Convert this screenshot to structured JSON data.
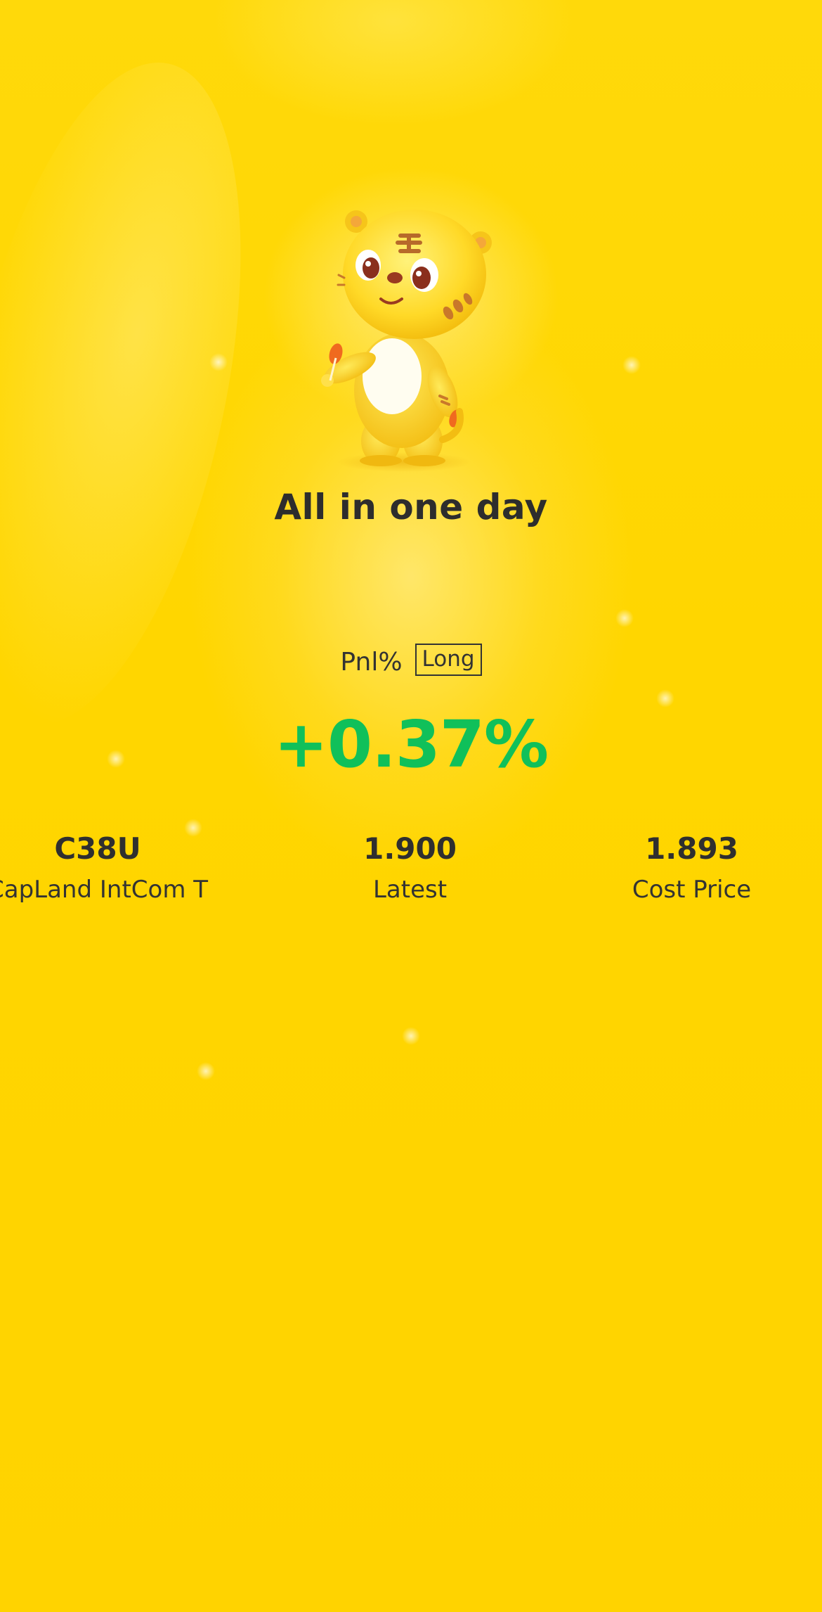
{
  "theme": {
    "background": "#ffd500",
    "positive": "#10c05a",
    "text": "#2d2d2d"
  },
  "card": {
    "mascot_icon": "tiger-mascot-icon",
    "title": "All in one day",
    "pnl_label": "Pnl%",
    "position_tag": "Long",
    "pnl_value": "+0.37%"
  },
  "stats": [
    {
      "value": "C38U",
      "label": "CapLand IntCom T"
    },
    {
      "value": "1.900",
      "label": "Latest"
    },
    {
      "value": "1.893",
      "label": "Cost Price"
    }
  ]
}
